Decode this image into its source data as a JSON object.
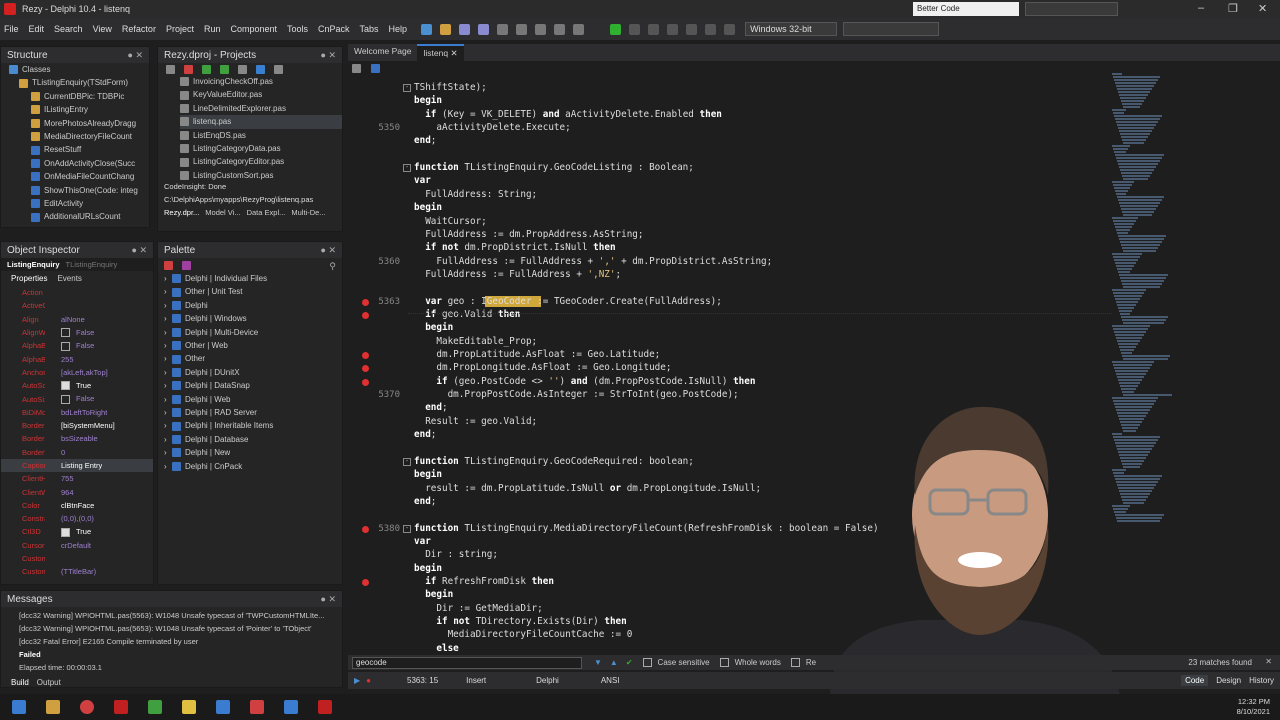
{
  "title": "Rezy - Delphi 10.4 - listenq",
  "layout_combo": "Better Code",
  "menu": [
    "File",
    "Edit",
    "Search",
    "View",
    "Refactor",
    "Project",
    "Run",
    "Component",
    "Tools",
    "CnPack",
    "Tabs",
    "Help"
  ],
  "platform": "Windows 32-bit",
  "structure": {
    "title": "Structure",
    "items": [
      "Classes",
      "TListingEnquiry(TStdForm)",
      "CurrentDBPic: TDBPic",
      "IListingEntry",
      "MorePhotosAlreadyDragg",
      "MediaDirectoryFileCount",
      "ResetStuff",
      "OnAddActivityClose(Succ",
      "OnMediaFileCountChang",
      "ShowThisOne(Code: integ",
      "EditActivity",
      "AdditionalURLsCount"
    ]
  },
  "projects": {
    "title": "Rezy.dproj - Projects",
    "items": [
      "InvoicingCheckOff.pas",
      "KeyValueEditor.pas",
      "LineDelimitedExplorer.pas",
      "listenq.pas",
      "ListEnqDS.pas",
      "ListingCategoryData.pas",
      "ListingCategoryEditor.pas",
      "ListingCustomSort.pas"
    ],
    "codeinsight": "CodeInsight: Done",
    "path": "C:\\DelphiApps\\myapps\\RezyProg\\listenq.pas",
    "tabs": [
      "Rezy.dpr...",
      "Model Vi...",
      "Data Expl...",
      "Multi-De..."
    ]
  },
  "inspector": {
    "title": "Object Inspector",
    "object": "ListingEnquiry",
    "object_type": "TListingEnquiry",
    "tabs": [
      "Properties",
      "Events"
    ],
    "rows": [
      {
        "k": "Action",
        "v": ""
      },
      {
        "k": "ActiveCon",
        "v": ""
      },
      {
        "k": "Align",
        "v": "alNone"
      },
      {
        "k": "AlignWithI",
        "v": "False",
        "cb": "off"
      },
      {
        "k": "AlphaBlen",
        "v": "False",
        "cb": "off"
      },
      {
        "k": "AlphaBlen",
        "v": "255"
      },
      {
        "k": "Anchors",
        "v": "[akLeft,akTop]"
      },
      {
        "k": "AutoScroll",
        "v": "True",
        "cb": "on"
      },
      {
        "k": "AutoSize",
        "v": "False",
        "cb": "off"
      },
      {
        "k": "BiDiMode",
        "v": "bdLeftToRight"
      },
      {
        "k": "BorderIco",
        "v": "[biSystemMenu]"
      },
      {
        "k": "BorderSty",
        "v": "bsSizeable"
      },
      {
        "k": "BorderWid",
        "v": "0"
      },
      {
        "k": "Caption",
        "v": "Listing Entry"
      },
      {
        "k": "ClientHeig",
        "v": "755"
      },
      {
        "k": "ClientWid",
        "v": "964"
      },
      {
        "k": "Color",
        "v": "clBtnFace"
      },
      {
        "k": "Constrain",
        "v": "(0,0),(0,0)"
      },
      {
        "k": "Ctl3D",
        "v": "True",
        "cb": "on"
      },
      {
        "k": "Cursor",
        "v": "crDefault"
      },
      {
        "k": "CustomH",
        "v": ""
      },
      {
        "k": "CustomTi",
        "v": "(TTitleBar)"
      }
    ]
  },
  "palette": {
    "title": "Palette",
    "items": [
      "Delphi | Individual Files",
      "Other | Unit Test",
      "Delphi",
      "Delphi | Windows",
      "Delphi | Multi-Device",
      "Other | Web",
      "Other",
      "Delphi | DUnitX",
      "Delphi | DataSnap",
      "Delphi | Web",
      "Delphi | RAD Server",
      "Delphi | Inheritable Items",
      "Delphi | Database",
      "Delphi | New",
      "Delphi | CnPack"
    ]
  },
  "messages": {
    "title": "Messages",
    "lines": [
      "[dcc32 Warning] WPIOHTML.pas(5563): W1048 Unsafe typecast of 'TWPCustomHTMLIte...",
      "[dcc32 Warning] WPIOHTML.pas(5653): W1048 Unsafe typecast of 'Pointer' to 'TObject'",
      "[dcc32 Fatal Error] E2165 Compile terminated by user"
    ],
    "failed": "Failed",
    "elapsed": "Elapsed time: 00:00:03.1",
    "tabs": [
      "Build",
      "Output"
    ]
  },
  "editor_tabs": [
    "Welcome Page",
    "listenq"
  ],
  "code": {
    "line_numbers": [
      "5350",
      "5360",
      "5363",
      "5370",
      "5380"
    ],
    "lines": [
      "TShiftState);",
      "begin",
      "  if (Key = VK_DELETE) and aActivityDelete.Enabled then",
      "    aActivityDelete.Execute;",
      "end;",
      "",
      "function TListingEnquiry.GeoCodeListing : Boolean;",
      "var",
      "  FullAddress: String;",
      "begin",
      "  WaitCursor;",
      "  FullAddress := dm.PropAddress.AsString;",
      "  if not dm.PropDistrict.IsNull then",
      "    FullAddress := FullAddress + ',' + dm.PropDistrict.AsString;",
      "  FullAddress := FullAddress + ',NZ';",
      "",
      "  var geo : IGeoCoder := TGeoCoder.Create(FullAddress);",
      "  if geo.Valid then",
      "  begin",
      "    MakeEditable_Prop;",
      "    dm.PropLatitude.AsFloat := Geo.Latitude;",
      "    dm.PropLongitude.AsFloat := Geo.Longitude;",
      "    if (geo.PostCode <> '') and (dm.PropPostCode.IsNull) then",
      "      dm.PropPostCode.AsInteger := StrToInt(geo.PostCode);",
      "  end;",
      "  Result := geo.Valid;",
      "end;",
      "",
      "function TListingEnquiry.GeoCodeRequired: boolean;",
      "begin",
      "  result := dm.PropLatitude.IsNull or dm.PropLongitude.IsNull;",
      "end;",
      "",
      "function TListingEnquiry.MediaDirectoryFileCount(RefreshFromDisk : boolean = False)",
      "var",
      "  Dir : string;",
      "begin",
      "  if RefreshFromDisk then",
      "  begin",
      "    Dir := GetMediaDir;",
      "    if not TDirectory.Exists(Dir) then",
      "      MediaDirectoryFileCountCache := 0",
      "    else"
    ]
  },
  "find": {
    "value": "geocode",
    "case_sensitive": "Case sensitive",
    "whole_words": "Whole words",
    "re": "Re",
    "matches": "23 matches found"
  },
  "status": {
    "position": "5363: 15",
    "mode": "Insert",
    "language": "Delphi",
    "encoding": "ANSI",
    "views": [
      "Code",
      "Design",
      "History"
    ]
  },
  "clock": {
    "time": "12:32 PM",
    "date": "8/10/2021"
  },
  "colors": {
    "accent": "#3a7dd0",
    "breakpoint": "#e03030",
    "highlight": "#f0c040"
  }
}
